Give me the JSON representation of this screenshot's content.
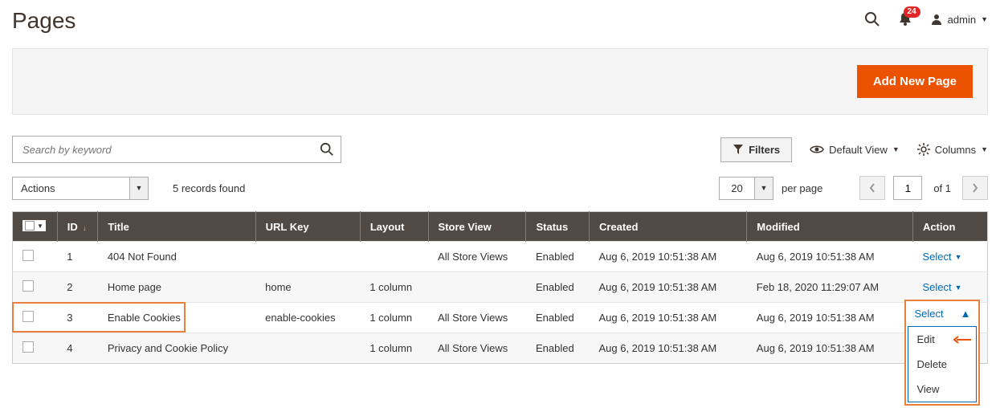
{
  "header": {
    "title": "Pages",
    "notifications_count": "24",
    "user_label": "admin"
  },
  "actions_bar": {
    "add_new_page": "Add New Page"
  },
  "search": {
    "placeholder": "Search by keyword"
  },
  "toolbar": {
    "filters": "Filters",
    "default_view": "Default View",
    "columns": "Columns"
  },
  "mid": {
    "actions_label": "Actions",
    "records_found": "5 records found",
    "per_page_value": "20",
    "per_page_label": "per page",
    "current_page": "1",
    "of_label": "of 1"
  },
  "columns": {
    "id": "ID",
    "title": "Title",
    "url_key": "URL Key",
    "layout": "Layout",
    "store_view": "Store View",
    "status": "Status",
    "created": "Created",
    "modified": "Modified",
    "action": "Action"
  },
  "rows": [
    {
      "id": "1",
      "title": "404 Not Found",
      "url_key": "",
      "layout": "",
      "store_view": "All Store Views",
      "status": "Enabled",
      "created": "Aug 6, 2019 10:51:38 AM",
      "modified": "Aug 6, 2019 10:51:38 AM"
    },
    {
      "id": "2",
      "title": "Home page",
      "url_key": "home",
      "layout": "1 column",
      "store_view": "",
      "status": "Enabled",
      "created": "Aug 6, 2019 10:51:38 AM",
      "modified": "Feb 18, 2020 11:29:07 AM"
    },
    {
      "id": "3",
      "title": "Enable Cookies",
      "url_key": "enable-cookies",
      "layout": "1 column",
      "store_view": "All Store Views",
      "status": "Enabled",
      "created": "Aug 6, 2019 10:51:38 AM",
      "modified": "Aug 6, 2019 10:51:38 AM"
    },
    {
      "id": "4",
      "title": "Privacy and Cookie Policy",
      "url_key": "",
      "layout": "1 column",
      "store_view": "All Store Views",
      "status": "Enabled",
      "created": "Aug 6, 2019 10:51:38 AM",
      "modified": "Aug 6, 2019 10:51:38 AM"
    }
  ],
  "action_select_label": "Select",
  "action_menu": {
    "edit": "Edit",
    "delete": "Delete",
    "view": "View"
  }
}
